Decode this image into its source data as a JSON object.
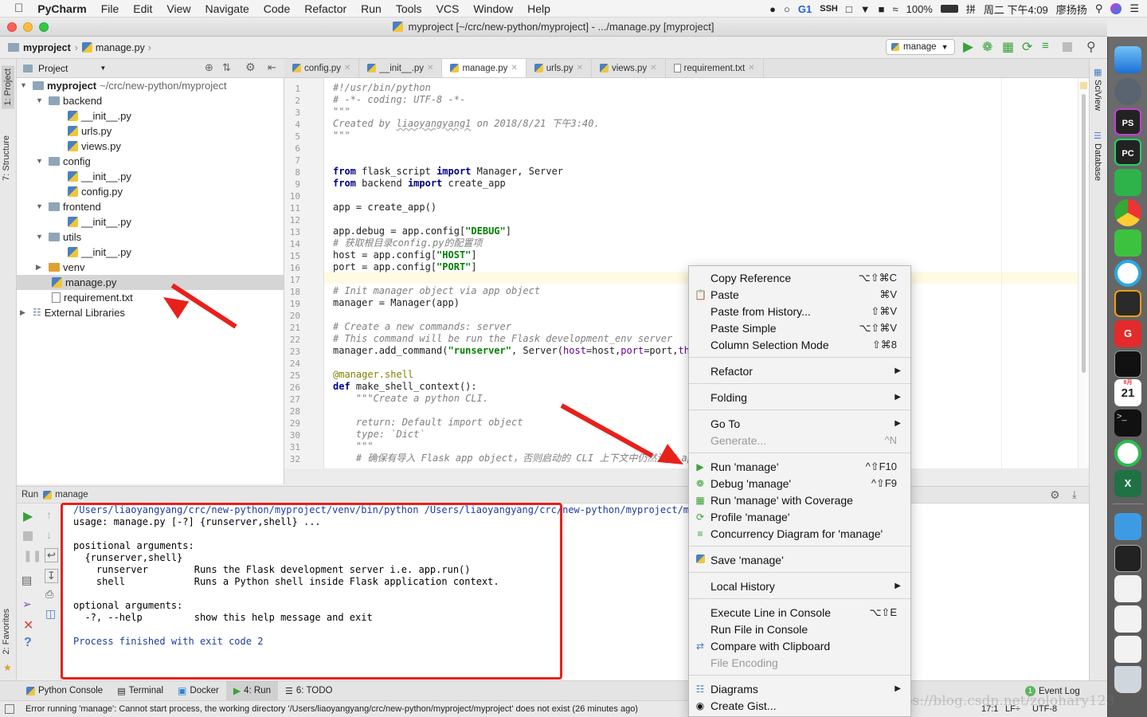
{
  "menubar": {
    "app_name": "PyCharm",
    "items": [
      "File",
      "Edit",
      "View",
      "Navigate",
      "Code",
      "Refactor",
      "Run",
      "Tools",
      "VCS",
      "Window",
      "Help"
    ],
    "battery": "100%",
    "clock": "周二 下午4:09",
    "user": "廖扬扬",
    "status_num": "1",
    "ssh_label": "SSH"
  },
  "window": {
    "title": "myproject [~/crc/new-python/myproject] - .../manage.py [myproject]"
  },
  "navbar": {
    "crumb_project": "myproject",
    "crumb_file": "manage.py",
    "run_config": "manage"
  },
  "left_strip": {
    "project": "1: Project",
    "structure": "7: Structure",
    "favorites": "2: Favorites"
  },
  "right_strip": {
    "sciview": "SciView",
    "database": "Database"
  },
  "project_panel": {
    "header": "Project",
    "root_name": "myproject",
    "root_path": "~/crc/new-python/myproject",
    "nodes": [
      {
        "label": "backend"
      },
      {
        "label": "__init__.py"
      },
      {
        "label": "urls.py"
      },
      {
        "label": "views.py"
      },
      {
        "label": "config"
      },
      {
        "label": "__init__.py"
      },
      {
        "label": "config.py"
      },
      {
        "label": "frontend"
      },
      {
        "label": "__init__.py"
      },
      {
        "label": "utils"
      },
      {
        "label": "__init__.py"
      },
      {
        "label": "venv"
      },
      {
        "label": "manage.py"
      },
      {
        "label": "requirement.txt"
      },
      {
        "label": "External Libraries"
      }
    ]
  },
  "editor_tabs": [
    "config.py",
    "__init__.py",
    "manage.py",
    "urls.py",
    "views.py",
    "requirement.txt"
  ],
  "line_numbers": [
    "1",
    "2",
    "3",
    "4",
    "5",
    "6",
    "7",
    "8",
    "9",
    "10",
    "11",
    "12",
    "13",
    "14",
    "15",
    "16",
    "17",
    "18",
    "19",
    "20",
    "21",
    "22",
    "23",
    "24",
    "25",
    "26",
    "27",
    "28",
    "29",
    "30",
    "31",
    "32"
  ],
  "code": {
    "l1": "#!/usr/bin/python",
    "l2": "# -*- coding: UTF-8 -*-",
    "l3": "\"\"\"",
    "l4a": "Created by ",
    "l4b": "liaoyangyang1",
    "l4c": " on 2018/8/21 下午3:40.",
    "l5": "\"\"\"",
    "l8_kw1": "from",
    "l8_mid": " flask_script ",
    "l8_kw2": "import",
    "l8_rest": " Manager, Server",
    "l9_kw1": "from",
    "l9_mid": " backend ",
    "l9_kw2": "import",
    "l9_rest": " create_app",
    "l11": "app = create_app()",
    "l13a": "app.debug = app.config[",
    "l13b": "\"DEBUG\"",
    "l13c": "]",
    "l14a": "# 获取根目录",
    "l14b": "config.py",
    "l14c": "的配置项",
    "l15a": "host = app.config[",
    "l15b": "\"HOST\"",
    "l15c": "]",
    "l16a": "port = app.config[",
    "l16b": "\"PORT\"",
    "l16c": "]",
    "l18": "# Init manager object via app object",
    "l19": "manager = Manager(app)",
    "l21": "# Create a new commands: server",
    "l22": "# This command will be run the Flask development_env server",
    "l23a": "manager.add_command(",
    "l23b": "\"runserver\"",
    "l23c": ", Server(",
    "l23d": "host",
    "l23e": "=host,",
    "l23f": "port",
    "l23g": "=port,",
    "l23h": "thre",
    "l25": "@manager.shell",
    "l26a": "def",
    "l26b": " make_shell_context():",
    "l27": "    \"\"\"Create a python CLI.",
    "l29": "    return: Default import object",
    "l30": "    type: `Dict`",
    "l31": "    \"\"\"",
    "l32a": "    # 确保有导入 ",
    "l32b": "Flask app object",
    "l32c": "，否则启动的 ",
    "l32d": "CLI",
    "l32e": " 上下文中仍然没有 ",
    "l32f": "ap"
  },
  "run_panel": {
    "header_label": "Run",
    "config_name": "manage",
    "console_lines": [
      "/Users/liaoyangyang/crc/new-python/myproject/venv/bin/python /Users/liaoyangyang/crc/new-python/myproject/manage",
      "usage: manage.py [-?] {runserver,shell} ...",
      "",
      "positional arguments:",
      "  {runserver,shell}",
      "    runserver        Runs the Flask development server i.e. app.run()",
      "    shell            Runs a Python shell inside Flask application context.",
      "",
      "optional arguments:",
      "  -?, --help         show this help message and exit",
      "",
      "Process finished with exit code 2"
    ]
  },
  "context_menu": {
    "items": [
      {
        "label": "Copy Reference",
        "shortcut": "⌥⇧⌘C"
      },
      {
        "label": "Paste",
        "shortcut": "⌘V"
      },
      {
        "label": "Paste from History...",
        "shortcut": "⇧⌘V"
      },
      {
        "label": "Paste Simple",
        "shortcut": "⌥⇧⌘V"
      },
      {
        "label": "Column Selection Mode",
        "shortcut": "⇧⌘8"
      },
      {
        "label": "Refactor",
        "shortcut": ""
      },
      {
        "label": "Folding",
        "shortcut": ""
      },
      {
        "label": "Go To",
        "shortcut": ""
      },
      {
        "label": "Generate...",
        "shortcut": "^N"
      },
      {
        "label": "Run 'manage'",
        "shortcut": "^⇧F10"
      },
      {
        "label": "Debug 'manage'",
        "shortcut": "^⇧F9"
      },
      {
        "label": "Run 'manage' with Coverage",
        "shortcut": ""
      },
      {
        "label": "Profile 'manage'",
        "shortcut": ""
      },
      {
        "label": "Concurrency Diagram for 'manage'",
        "shortcut": ""
      },
      {
        "label": "Save 'manage'",
        "shortcut": ""
      },
      {
        "label": "Local History",
        "shortcut": ""
      },
      {
        "label": "Execute Line in Console",
        "shortcut": "⌥⇧E"
      },
      {
        "label": "Run File in Console",
        "shortcut": ""
      },
      {
        "label": "Compare with Clipboard",
        "shortcut": ""
      },
      {
        "label": "File Encoding",
        "shortcut": ""
      },
      {
        "label": "Diagrams",
        "shortcut": ""
      },
      {
        "label": "Create Gist...",
        "shortcut": ""
      }
    ]
  },
  "bottom_tabs": [
    {
      "label": "Python Console"
    },
    {
      "label": "Terminal"
    },
    {
      "label": "Docker"
    },
    {
      "label": "4: Run"
    },
    {
      "label": "6: TODO"
    }
  ],
  "event_log": {
    "label": "Event Log",
    "count": "1"
  },
  "statusbar": {
    "message": "Error running 'manage': Cannot start process, the working directory '/Users/liaoyangyang/crc/new-python/myproject/myproject' does not exist (26 minutes ago)",
    "position": "17:1",
    "line_sep": "LF÷",
    "encoding": "UTF-8"
  },
  "watermark": "https://blog.csdn.net/zolohary123",
  "dock": {
    "calendar_day": "21",
    "calendar_month": "8月"
  },
  "colors": {
    "accent_red": "#e8201a",
    "run_green": "#3aa13a",
    "keyword": "#000080",
    "string": "#008000"
  }
}
